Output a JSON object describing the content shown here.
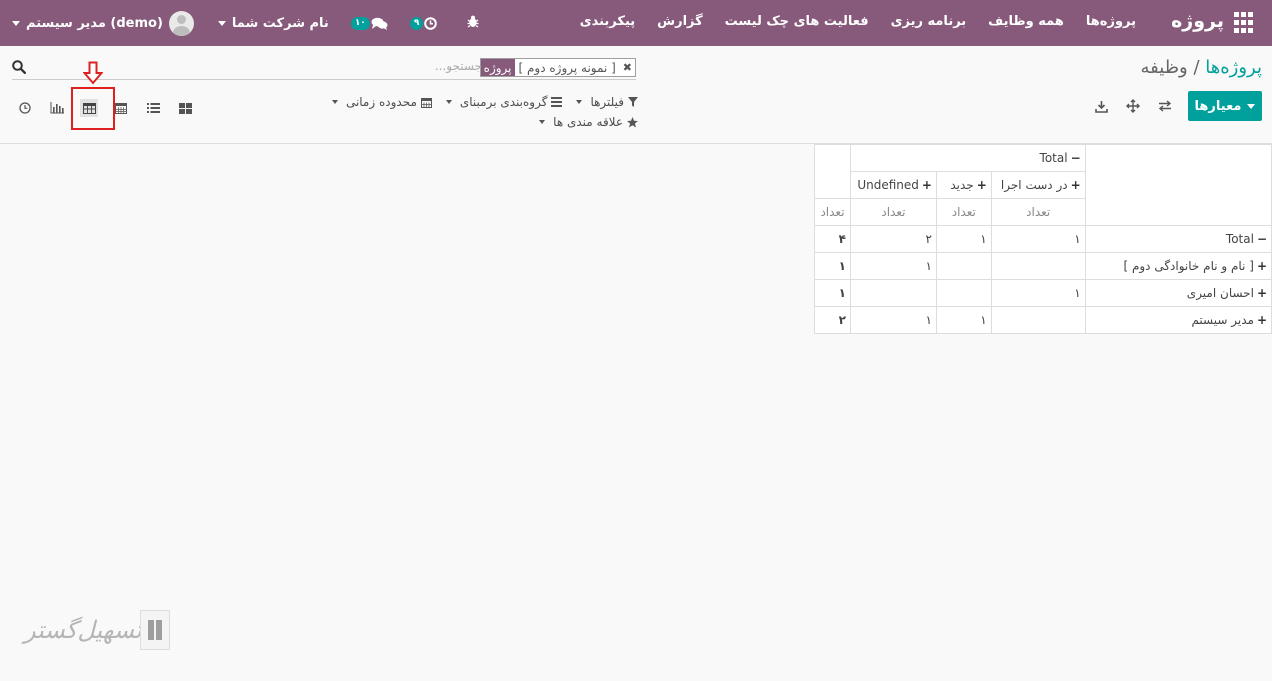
{
  "navbar": {
    "brand": "پروژه",
    "menu": [
      "پروژه‌ها",
      "همه وظایف",
      "برنامه ریزی",
      "فعالیت های چک لیست",
      "گزارش",
      "پیکربندی"
    ],
    "user_name": "مدیر سیستم (demo)",
    "company_name": "نام شرکت شما",
    "messages_count": "۱۰",
    "activities_count": "۹"
  },
  "breadcrumb": {
    "parent": "پروژه‌ها",
    "separator": "/",
    "current": "وظیفه"
  },
  "search": {
    "facet_label": "پروژه",
    "facet_value": "[ نمونه پروژه دوم ]",
    "facet_remove": "✖",
    "placeholder": "جستجو..."
  },
  "toolbar": {
    "measures_label": "معیارها"
  },
  "search_options": {
    "filters": "فیلترها",
    "group_by": "گروه‌بندی برمبنای",
    "time_range": "محدوده زمانی",
    "favorites": "علاقه مندی ها"
  },
  "pivot": {
    "total_label": "Total",
    "columns": [
      "در دست اجرا",
      "جدید",
      "Undefined"
    ],
    "measure_label": "تعداد",
    "total_row": {
      "values": [
        "۱",
        "۱",
        "۲"
      ],
      "total": "۴"
    },
    "rows": [
      {
        "label": "[ نام و نام خانوادگی دوم ]",
        "values": [
          "",
          "",
          "۱"
        ],
        "total": "۱"
      },
      {
        "label": "احسان امیری",
        "values": [
          "۱",
          "",
          ""
        ],
        "total": "۱"
      },
      {
        "label": "مدیر سیستم",
        "values": [
          "",
          "۱",
          "۱"
        ],
        "total": "۲"
      }
    ]
  },
  "watermark": {
    "text": "تسهیل‌گستر"
  },
  "colors": {
    "brand": "#875a7b",
    "accent": "#00a09d",
    "highlight": "#e02020"
  }
}
